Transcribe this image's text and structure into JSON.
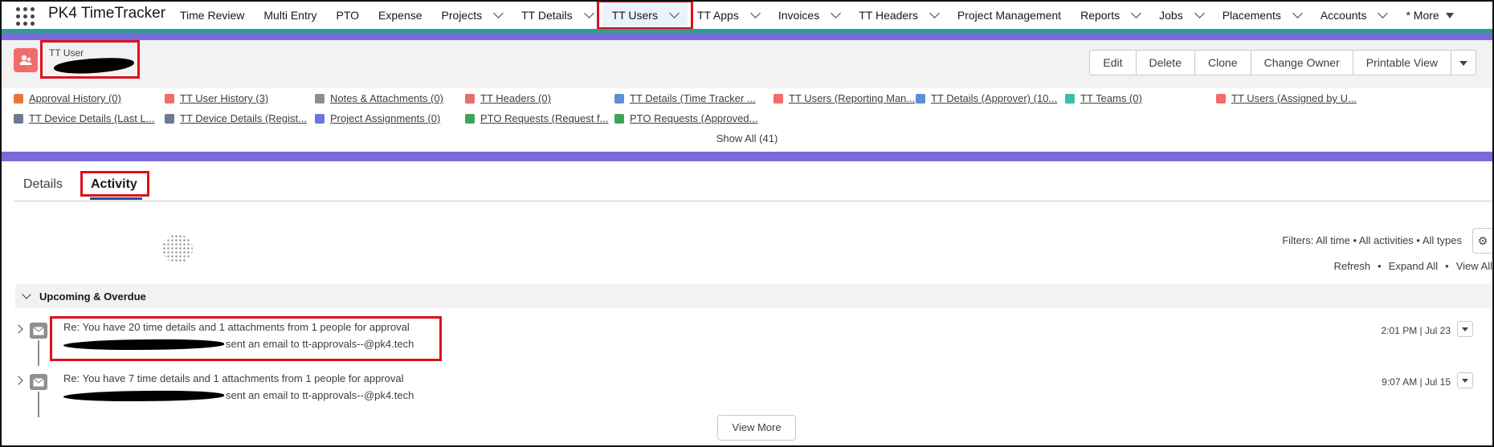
{
  "app": {
    "name": "PK4 TimeTracker"
  },
  "nav": {
    "items": [
      {
        "label": "Time Review",
        "chevron": false
      },
      {
        "label": "Multi Entry",
        "chevron": false
      },
      {
        "label": "PTO",
        "chevron": false
      },
      {
        "label": "Expense",
        "chevron": false
      },
      {
        "label": "Projects",
        "chevron": true
      },
      {
        "label": "TT Details",
        "chevron": true
      },
      {
        "label": "TT Users",
        "chevron": true,
        "active": true
      },
      {
        "label": "TT Apps",
        "chevron": true
      },
      {
        "label": "Invoices",
        "chevron": true
      },
      {
        "label": "TT Headers",
        "chevron": true
      },
      {
        "label": "Project Management",
        "chevron": false
      },
      {
        "label": "Reports",
        "chevron": true
      },
      {
        "label": "Jobs",
        "chevron": true
      },
      {
        "label": "Placements",
        "chevron": true
      },
      {
        "label": "Accounts",
        "chevron": true
      },
      {
        "label": "* More",
        "chevron": false
      }
    ]
  },
  "header": {
    "object_label": "TT User",
    "actions": [
      "Edit",
      "Delete",
      "Clone",
      "Change Owner",
      "Printable View"
    ]
  },
  "related": {
    "row1": [
      {
        "label": "Approval History (0)",
        "color": "#e8773a"
      },
      {
        "label": "TT User History (3)",
        "color": "#f26b6b"
      },
      {
        "label": "Notes & Attachments (0)",
        "color": "#8f8f8f"
      },
      {
        "label": "TT Headers (0)",
        "color": "#e36f6f"
      },
      {
        "label": "TT Details (Time Tracker ...",
        "color": "#5b8fd8"
      },
      {
        "label": "TT Users (Reporting Man...",
        "color": "#f26b6b"
      },
      {
        "label": "TT Details (Approver) (10...",
        "color": "#5b8fd8"
      },
      {
        "label": "TT Teams (0)",
        "color": "#3cbfa6"
      },
      {
        "label": "TT Users (Assigned by U...",
        "color": "#f26b6b"
      }
    ],
    "row2": [
      {
        "label": "TT Device Details (Last L...",
        "color": "#6d7a90"
      },
      {
        "label": "TT Device Details (Regist...",
        "color": "#6d7a90"
      },
      {
        "label": "Project Assignments (0)",
        "color": "#6a75e0"
      },
      {
        "label": "PTO Requests (Request f...",
        "color": "#3ea35a"
      },
      {
        "label": "PTO Requests (Approved...",
        "color": "#3ea35a"
      }
    ],
    "show_all": "Show All (41)"
  },
  "tabs": [
    {
      "label": "Details",
      "active": false
    },
    {
      "label": "Activity",
      "active": true
    }
  ],
  "activity": {
    "filters": "Filters: All time • All activities • All types",
    "refresh": "Refresh",
    "expand_all": "Expand All",
    "view_all": "View All",
    "section": "Upcoming & Overdue",
    "items": [
      {
        "subject": "Re: You have 20 time details and 1 attachments from 1 people for approval",
        "desc": "sent an email to tt-approvals--@pk4.tech",
        "time": "2:01 PM | Jul 23"
      },
      {
        "subject": "Re: You have 7 time details and 1 attachments from 1 people for approval",
        "desc": "sent an email to tt-approvals--@pk4.tech",
        "time": "9:07 AM | Jul 15"
      }
    ],
    "view_more": "View More"
  }
}
